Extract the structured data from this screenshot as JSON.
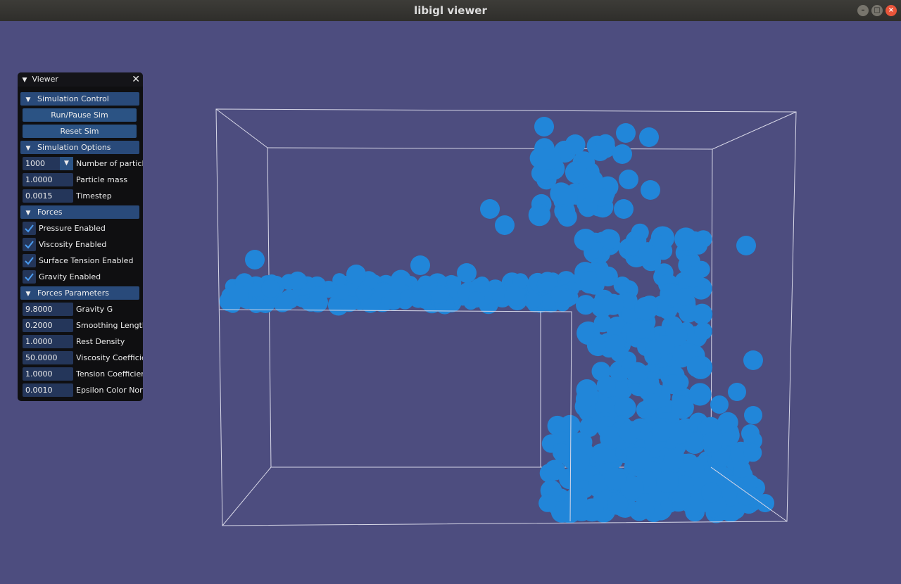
{
  "window": {
    "title": "libigl viewer"
  },
  "colors": {
    "background": "#4d4d7f",
    "particle": "#2186d9",
    "box": "#d8d8e8"
  },
  "viewer": {
    "title": "Viewer",
    "sections": {
      "simulation_control": "Simulation Control",
      "simulation_options": "Simulation Options",
      "forces": "Forces",
      "forces_parameters": "Forces Parameters"
    },
    "buttons": {
      "run_pause": "Run/Pause Sim",
      "reset": "Reset Sim"
    },
    "options": {
      "num_particles": {
        "value": "1000",
        "label": "Number of particles"
      },
      "particle_mass": {
        "value": "1.0000",
        "label": "Particle mass"
      },
      "timestep": {
        "value": "0.0015",
        "label": "Timestep"
      }
    },
    "forces": {
      "pressure": {
        "label": "Pressure Enabled",
        "checked": true
      },
      "viscosity": {
        "label": "Viscosity Enabled",
        "checked": true
      },
      "surface_tension": {
        "label": "Surface Tension Enabled",
        "checked": true
      },
      "gravity": {
        "label": "Gravity Enabled",
        "checked": true
      }
    },
    "parameters": {
      "gravity_g": {
        "value": "9.8000",
        "label": "Gravity G"
      },
      "smoothing_length": {
        "value": "0.2000",
        "label": "Smoothing Length"
      },
      "rest_density": {
        "value": "1.0000",
        "label": "Rest Density"
      },
      "viscosity_coefficient": {
        "value": "50.0000",
        "label": "Viscosity Coefficient"
      },
      "tension_coefficient": {
        "value": "1.0000",
        "label": "Tension Coefficient"
      },
      "epsilon_color_norm": {
        "value": "0.0010",
        "label": "Epsilon Color Norm"
      }
    }
  }
}
